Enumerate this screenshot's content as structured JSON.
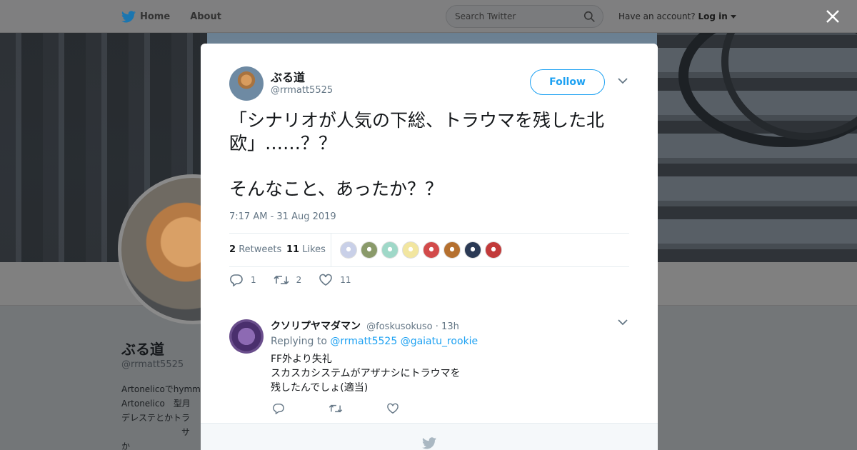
{
  "nav": {
    "home_label": "Home",
    "about_label": "About",
    "search_placeholder": "Search Twitter",
    "account_prompt": "Have an account?",
    "login_label": "Log in"
  },
  "profile": {
    "name": "ぶる道",
    "handle": "@rrmatt5525",
    "bio_lines": [
      "Artonelicoでhymm",
      "Artonelico　型月",
      "デレステとかトラ",
      "　　　　　　　サ",
      "か"
    ]
  },
  "tweet": {
    "author_name": "ぶる道",
    "author_handle": "@rrmatt5525",
    "follow_label": "Follow",
    "text": "「シナリオが人気の下総、トラウマを残した北欧」……？？\n\nそんなこと、あったか？？",
    "timestamp": "7:17 AM - 31 Aug 2019",
    "retweets_count": "2",
    "retweets_label": "Retweets",
    "likes_count": "11",
    "likes_label": "Likes",
    "actions": {
      "reply_count": "1",
      "retweet_count": "2",
      "like_count": "11"
    },
    "liker_colors": [
      "#c9d0e8",
      "#8a9a6a",
      "#9fd8c8",
      "#f2e6a0",
      "#d24a4a",
      "#b5702f",
      "#2b3a55",
      "#c23a3a"
    ]
  },
  "reply": {
    "author_name": "クソリプヤマダマン",
    "author_handle": "@foskusokuso",
    "time": "· 13h",
    "replying_to_label": "Replying to",
    "mention1": "@rrmatt5525",
    "mention2": "@gaiatu_rookie",
    "text": "FF外より失礼\nスカスカシステムがアザナシにトラウマを\n残したんでしょ(適当)"
  },
  "colors": {
    "accent": "#1da1f2",
    "secondary_text": "#657786"
  }
}
